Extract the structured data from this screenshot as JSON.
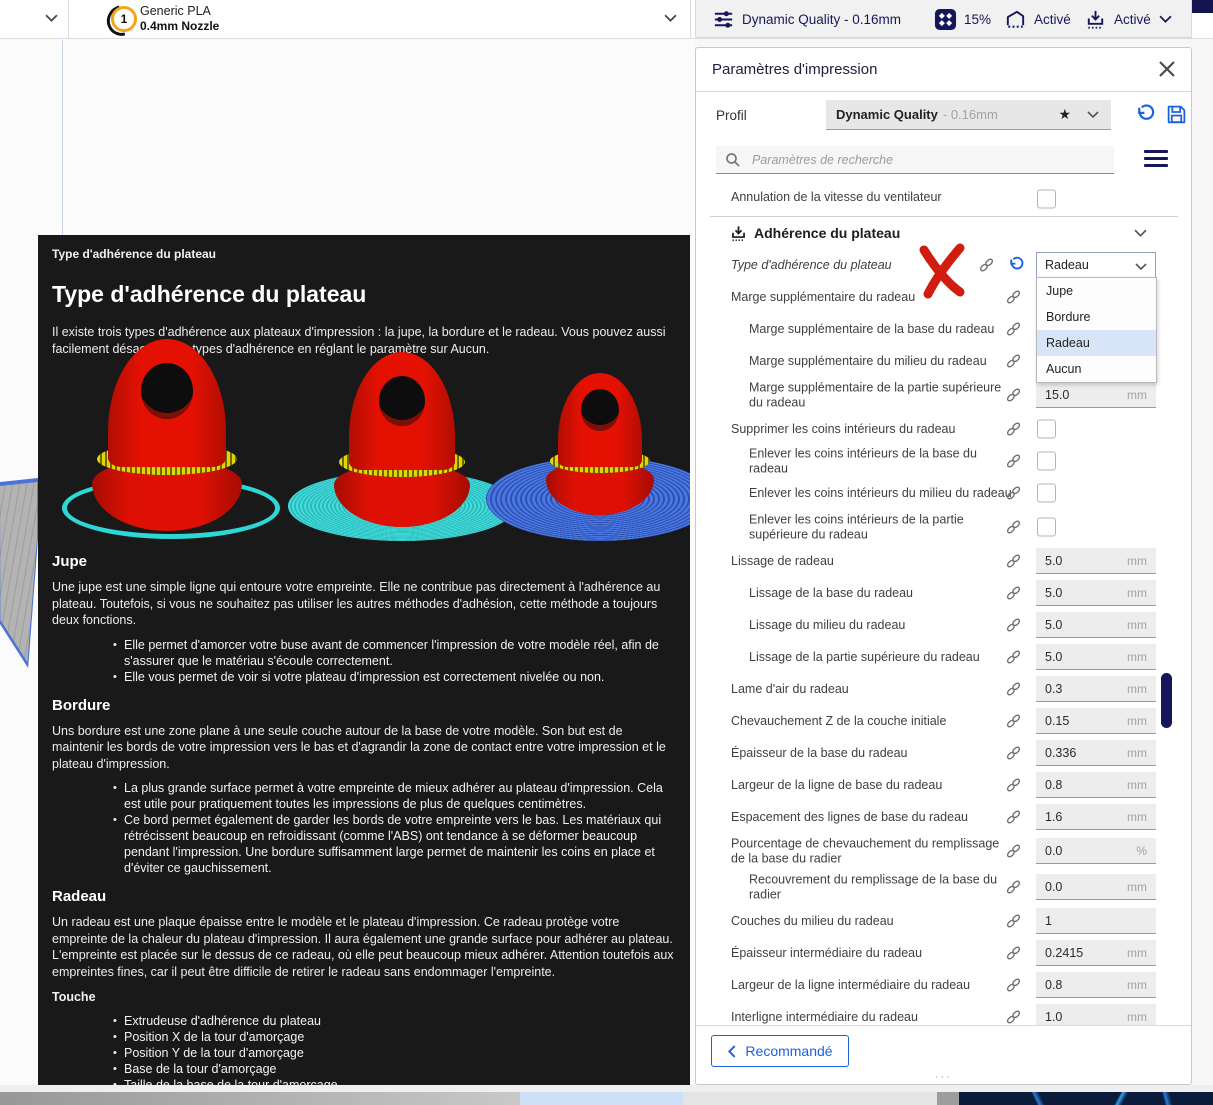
{
  "colors": {
    "accent_blue": "#1c62e0",
    "navy": "#16165c",
    "selected_option_bg": "#d8e5f8",
    "annotation_red": "#d01d10",
    "tooltip_bg": "#191919"
  },
  "topbar": {
    "extruder": {
      "number": "1",
      "material": "Generic PLA",
      "nozzle": "0.4mm Nozzle"
    },
    "summary": {
      "profile": "Dynamic Quality - 0.16mm",
      "infill": "15%",
      "support": "Activé",
      "adhesion": "Activé"
    }
  },
  "panel": {
    "title": "Paramètres d'impression",
    "profil_label": "Profil",
    "profile_name": "Dynamic Quality",
    "profile_suffix": "- 0.16mm",
    "search_placeholder": "Paramètres de recherche",
    "fan_label": "Annulation de la vitesse du ventilateur",
    "category": "Adhérence du plateau",
    "dropdown": {
      "value": "Radeau",
      "options": [
        "Jupe",
        "Bordure",
        "Radeau",
        "Aucun"
      ],
      "selected_index": 2
    },
    "rows": [
      {
        "label": "Type d'adhérence du plateau",
        "indent": 0,
        "italic": true,
        "control": "select",
        "revert": true,
        "annotated": true
      },
      {
        "label": "Marge supplémentaire du radeau",
        "indent": 0,
        "control": "none"
      },
      {
        "label": "Marge supplémentaire de la base du radeau",
        "indent": 1,
        "control": "none"
      },
      {
        "label": "Marge supplémentaire du milieu du radeau",
        "indent": 1,
        "control": "none"
      },
      {
        "label": "Marge supplémentaire de la partie supérieure du radeau",
        "indent": 1,
        "two": true,
        "control": "value",
        "value": "15.0",
        "unit": "mm"
      },
      {
        "label": "Supprimer les coins intérieurs du radeau",
        "indent": 0,
        "control": "checkbox"
      },
      {
        "label": "Enlever les coins intérieurs de la base du radeau",
        "indent": 1,
        "control": "checkbox"
      },
      {
        "label": "Enlever les coins intérieurs du milieu du radeau",
        "indent": 1,
        "control": "checkbox"
      },
      {
        "label": "Enlever les coins intérieurs de la partie supérieure du radeau",
        "indent": 1,
        "two": true,
        "control": "checkbox"
      },
      {
        "label": "Lissage de radeau",
        "indent": 0,
        "control": "value",
        "value": "5.0",
        "unit": "mm"
      },
      {
        "label": "Lissage de la base du radeau",
        "indent": 1,
        "control": "value",
        "value": "5.0",
        "unit": "mm"
      },
      {
        "label": "Lissage du milieu du radeau",
        "indent": 1,
        "control": "value",
        "value": "5.0",
        "unit": "mm"
      },
      {
        "label": "Lissage de la partie supérieure du radeau",
        "indent": 1,
        "control": "value",
        "value": "5.0",
        "unit": "mm"
      },
      {
        "label": "Lame d'air du radeau",
        "indent": 0,
        "control": "value",
        "value": "0.3",
        "unit": "mm"
      },
      {
        "label": "Chevauchement Z de la couche initiale",
        "indent": 0,
        "control": "value",
        "value": "0.15",
        "unit": "mm"
      },
      {
        "label": "Épaisseur de la base du radeau",
        "indent": 0,
        "control": "value",
        "value": "0.336",
        "unit": "mm"
      },
      {
        "label": "Largeur de la ligne de base du radeau",
        "indent": 0,
        "control": "value",
        "value": "0.8",
        "unit": "mm"
      },
      {
        "label": "Espacement des lignes de base du radeau",
        "indent": 0,
        "control": "value",
        "value": "1.6",
        "unit": "mm"
      },
      {
        "label": "Pourcentage de chevauchement du remplissage de la base du radier",
        "indent": 0,
        "two": true,
        "control": "value",
        "value": "0.0",
        "unit": "%"
      },
      {
        "label": "Recouvrement du remplissage de la base du radier",
        "indent": 1,
        "two": true,
        "control": "value",
        "value": "0.0",
        "unit": "mm"
      },
      {
        "label": "Couches du milieu du radeau",
        "indent": 0,
        "control": "value",
        "value": "1",
        "unit": ""
      },
      {
        "label": "Épaisseur intermédiaire du radeau",
        "indent": 0,
        "control": "value",
        "value": "0.2415",
        "unit": "mm"
      },
      {
        "label": "Largeur de la ligne intermédiaire du radeau",
        "indent": 0,
        "control": "value",
        "value": "0.8",
        "unit": "mm"
      },
      {
        "label": "Interligne intermédiaire du radeau",
        "indent": 0,
        "control": "value",
        "value": "1.0",
        "unit": "mm"
      }
    ],
    "footer_button": "Recommandé"
  },
  "tooltip": {
    "header": "Type d'adhérence du plateau",
    "title": "Type d'adhérence du plateau",
    "intro": "Il existe trois types d'adhérence aux plateaux d'impression : la jupe, la bordure et le radeau. Vous pouvez aussi facilement désactiver les types d'adhérence en réglant le paramètre sur Aucun.",
    "sections": [
      {
        "heading": "Jupe",
        "body": "Une jupe est une simple ligne qui entoure votre empreinte. Elle ne contribue pas directement à l'adhérence au plateau. Toutefois, si vous ne souhaitez pas utiliser les autres méthodes d'adhésion, cette méthode a toujours deux fonctions.",
        "bullets": [
          "Elle permet d'amorcer votre buse avant de commencer l'impression de votre modèle réel, afin de s'assurer que le matériau s'écoule correctement.",
          "Elle vous permet de voir si votre plateau d'impression est correctement nivelée ou non."
        ]
      },
      {
        "heading": "Bordure",
        "body": "Uns bordure est une zone plane à une seule couche autour de la base de votre modèle. Son but est de maintenir les bords de votre impression vers le bas et d'agrandir la zone de contact entre votre impression et le plateau d'impression.",
        "bullets": [
          "La plus grande surface permet à votre empreinte de mieux adhérer au plateau d'impression. Cela est utile pour pratiquement toutes les impressions de plus de quelques centimètres.",
          "Ce bord permet également de garder les bords de votre empreinte vers le bas. Les matériaux qui rétrécissent beaucoup en refroidissant (comme l'ABS) ont tendance à se déformer beaucoup pendant l'impression. Une bordure suffisamment large permet de maintenir les coins en place et d'éviter ce gauchissement."
        ]
      },
      {
        "heading": "Radeau",
        "body": "Un radeau est une plaque épaisse entre le modèle et le plateau d'impression. Ce radeau protège votre empreinte de la chaleur du plateau d'impression. Il aura également une grande surface pour adhérer au plateau. L'empreinte est placée sur le dessus de ce radeau, où elle peut beaucoup mieux adhérer. Attention toutefois aux empreintes fines, car il peut être difficile de retirer le radeau sans endommager l'empreinte.",
        "bullets": []
      }
    ],
    "touche_label": "Touche",
    "touche_items": [
      "Extrudeuse d'adhérence du plateau",
      "Position X de la tour d'amorçage",
      "Position Y de la tour d'amorçage",
      "Base de la tour d'amorçage",
      "Taille de la base de la tour d'amorçage"
    ]
  }
}
